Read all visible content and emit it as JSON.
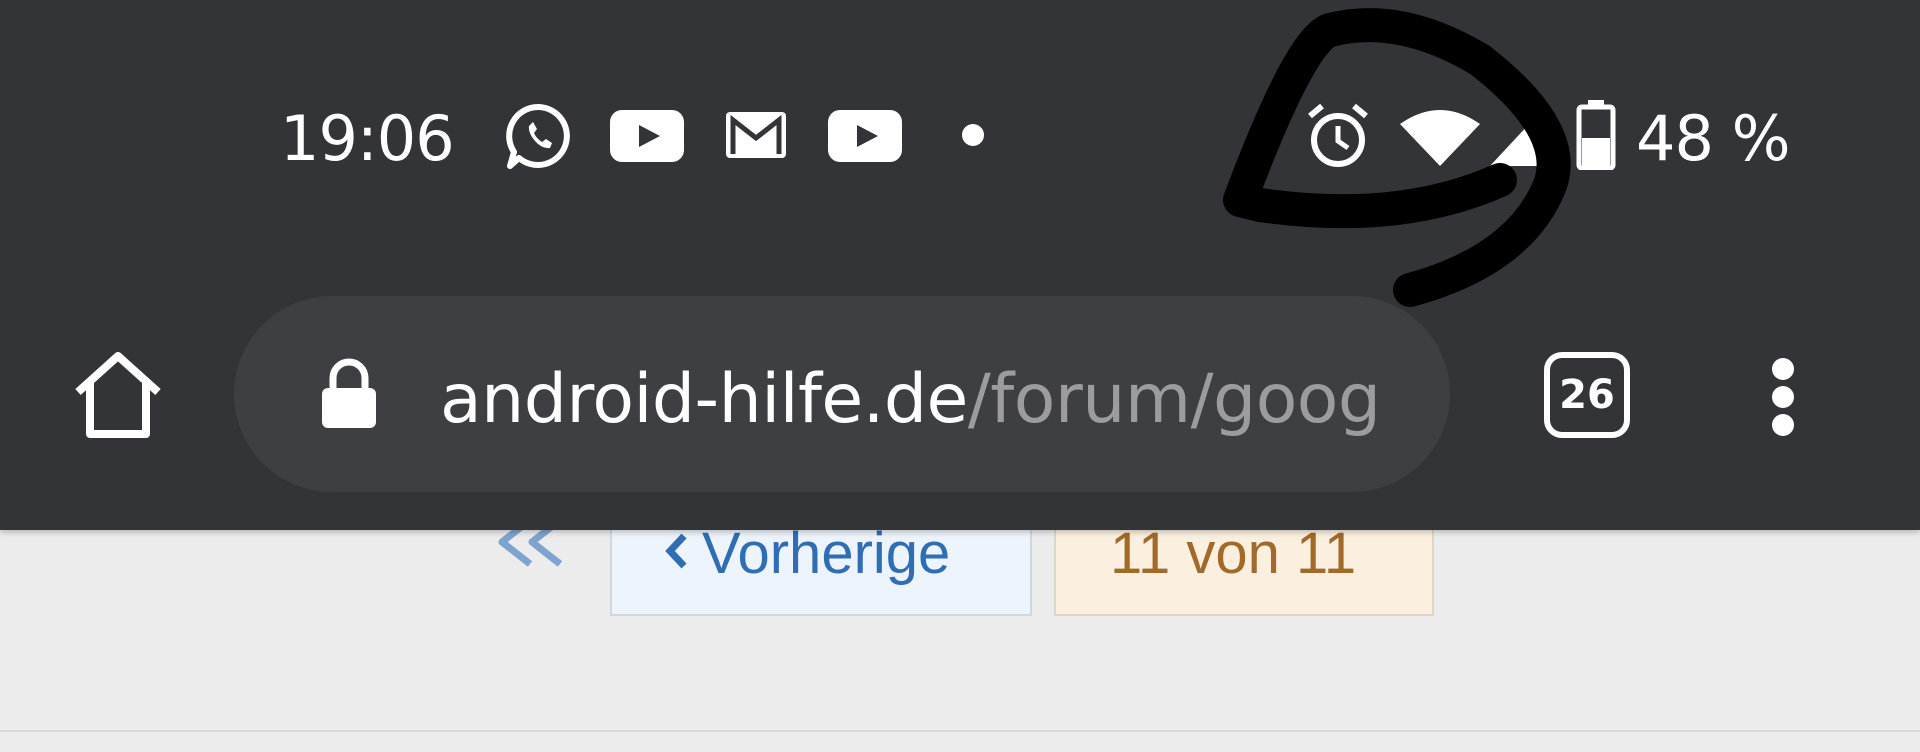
{
  "status_bar": {
    "time": "19:06",
    "notification_icons": [
      "whatsapp-icon",
      "youtube-icon",
      "gmail-icon",
      "youtube-icon",
      "more-notifications-dot"
    ],
    "system_icons": [
      "alarm-icon",
      "wifi-icon",
      "signal-icon",
      "battery-icon"
    ],
    "battery_percent": "48 %"
  },
  "toolbar": {
    "home_icon": "home-icon",
    "lock_icon": "lock-icon",
    "url_domain": "android-hilfe.de",
    "url_path": "/forum/goog",
    "tab_count": "26",
    "menu_icon": "more-vert-icon"
  },
  "page": {
    "first_page_icon": "double-chevron-left-icon",
    "prev_label": "Vorherige",
    "page_indicator": "11 von 11"
  },
  "colors": {
    "chrome_bg": "#333438",
    "omnibox_bg": "#3d3f43",
    "link_blue": "#2f6db5",
    "page_count_text": "#a1692a"
  }
}
